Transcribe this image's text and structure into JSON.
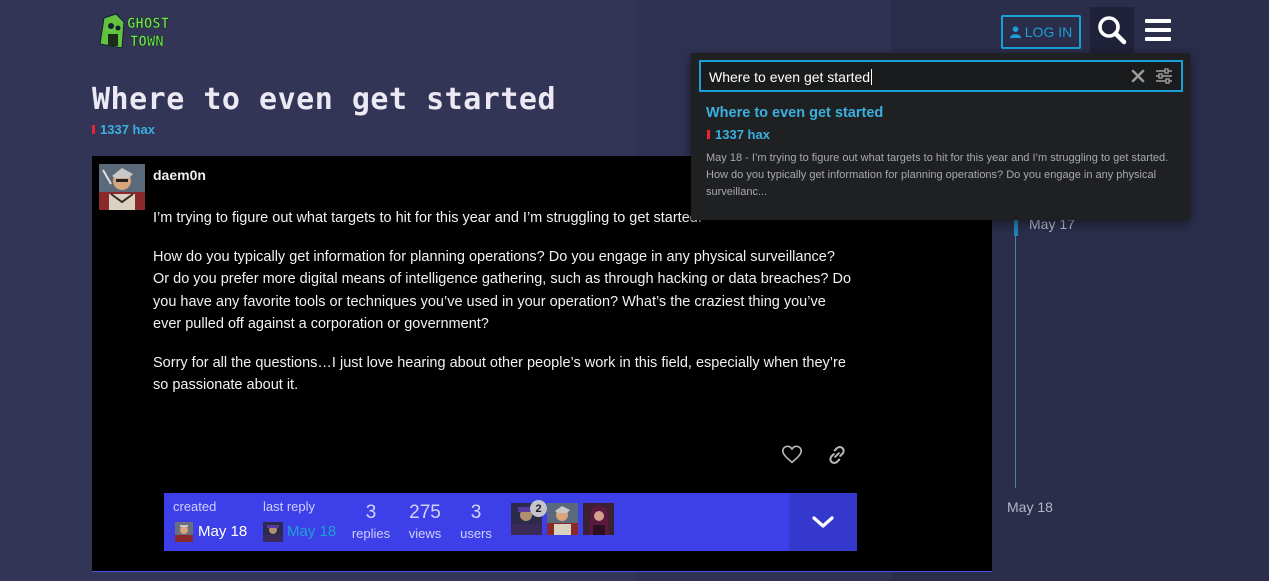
{
  "header": {
    "logo_text": "GHOST TOWN",
    "login_label": "LOG IN",
    "icons": {
      "login": "user-icon",
      "search": "search-icon",
      "menu": "hamburger-icon"
    }
  },
  "topic": {
    "title": "Where to even get started",
    "category": {
      "name": "1337 hax",
      "color": "#e5263a"
    }
  },
  "post": {
    "username": "daem0n",
    "paragraphs": [
      "I’m trying to figure out what targets to hit for this year and I’m struggling to get started.",
      "How do you typically get information for planning operations? Do you engage in any physical surveillance? Or do you prefer more digital means of intelligence gathering, such as through hacking or data breaches? Do you have any favorite tools or techniques you’ve used in your operation? What’s the craziest thing you’ve ever pulled off against a corporation or government?",
      "Sorry for all the questions…I just love hearing about other people’s work in this field, especially when they’re so passionate about it."
    ],
    "actions": {
      "like": "heart-icon",
      "share": "link-icon"
    }
  },
  "topic_map": {
    "created_label": "created",
    "created_date": "May 18",
    "last_reply_label": "last reply",
    "last_reply_date": "May 18",
    "replies": {
      "count": "3",
      "label": "replies"
    },
    "views": {
      "count": "275",
      "label": "views"
    },
    "users": {
      "count": "3",
      "label": "users"
    },
    "participant_badge": "2",
    "expand_icon": "chevron-down-icon"
  },
  "timeline": {
    "top_date": "May 17",
    "bottom_date": "May 18"
  },
  "search": {
    "query": "Where to even get started",
    "icons": {
      "clear": "close-icon",
      "advanced": "sliders-icon"
    },
    "results": [
      {
        "title": "Where to even get started",
        "category": "1337 hax",
        "blurb": "May 18 - I’m trying to figure out what targets to hit for this year and I’m struggling to get started. How do you typically get information for planning operations? Do you engage in any physical surveillanc..."
      }
    ]
  },
  "colors": {
    "accent": "#1a9fd8",
    "topic_map_bg": "#3d40e8",
    "category": "#e5263a",
    "page_bg": "#2b2e4a"
  }
}
